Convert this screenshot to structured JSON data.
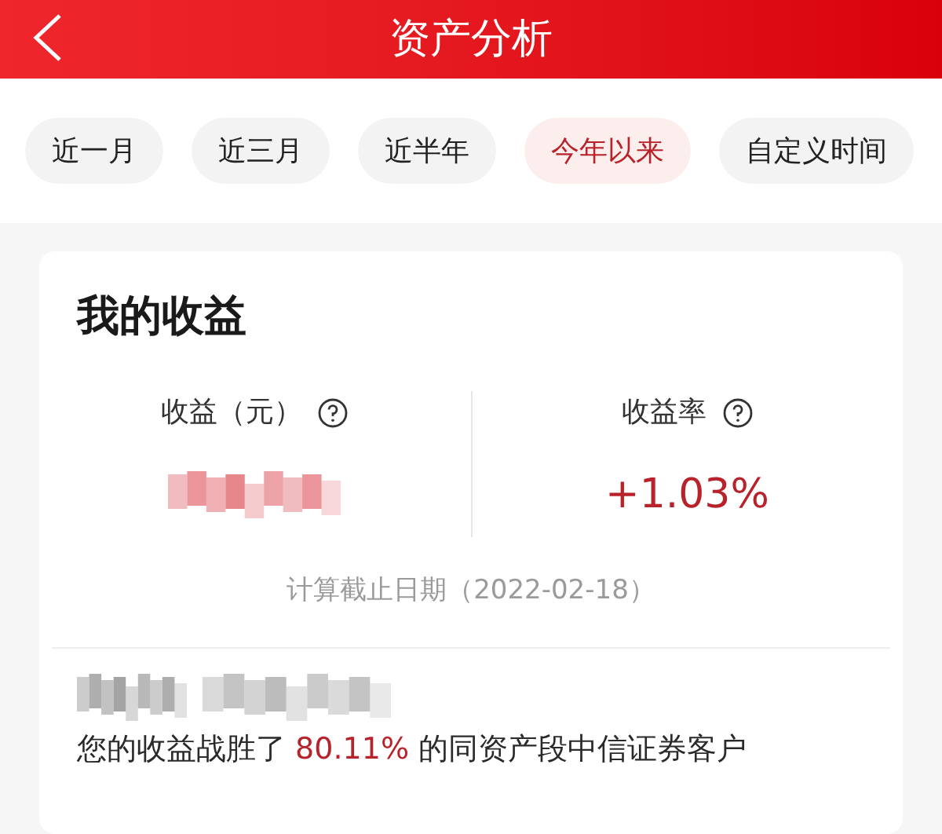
{
  "header": {
    "title": "资产分析"
  },
  "tabs": [
    {
      "label": "近一月",
      "selected": false
    },
    {
      "label": "近三月",
      "selected": false
    },
    {
      "label": "近半年",
      "selected": false
    },
    {
      "label": "今年以来",
      "selected": true
    },
    {
      "label": "自定义时间",
      "selected": false
    }
  ],
  "earnings_card": {
    "title": "我的收益",
    "metrics": [
      {
        "label": "收益（元）",
        "kind": "hidden"
      },
      {
        "label": "收益率",
        "kind": "value",
        "value": "+1.03%"
      }
    ],
    "as_of": "计算截止日期（2022-02-18）",
    "ranking": [
      {
        "text": "您的收益战胜了 ",
        "kind": "plain"
      },
      {
        "text": "80.11%",
        "kind": "highlight"
      },
      {
        "text": " 的同资产段中信证券客户",
        "kind": "plain"
      }
    ]
  }
}
